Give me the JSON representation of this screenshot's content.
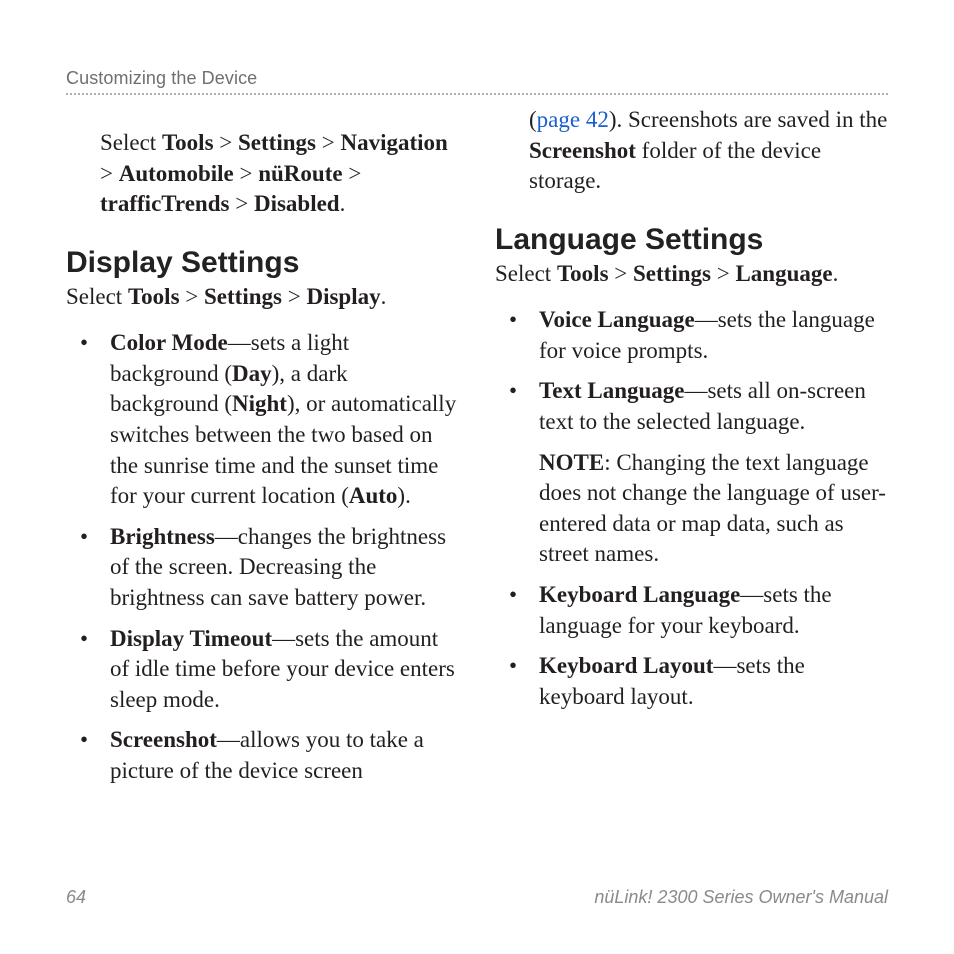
{
  "running_head": "Customizing the Device",
  "left": {
    "lead_in": {
      "prefix": "Select ",
      "crumbs": [
        "Tools",
        "Settings",
        "Navigation",
        "Automobile",
        "nüRoute",
        "trafficTrends",
        "Disabled"
      ],
      "sep": " > ",
      "suffix": "."
    },
    "section_title": "Display Settings",
    "subhead": {
      "prefix": "Select ",
      "crumbs": [
        "Tools",
        "Settings",
        "Display"
      ],
      "sep": " > ",
      "suffix": "."
    },
    "items": [
      {
        "term": "Color Mode",
        "parts": [
          "—sets a light background (",
          {
            "b": "Day"
          },
          "), a dark background (",
          {
            "b": "Night"
          },
          "), or automatically switches between the two based on the sunrise time and the sunset time for your current location (",
          {
            "b": "Auto"
          },
          ")."
        ]
      },
      {
        "term": "Brightness",
        "parts": [
          "—changes the brightness of the screen. Decreasing the brightness can save battery power."
        ]
      },
      {
        "term": "Display Timeout",
        "parts": [
          "—sets the amount of idle time before your device enters sleep mode."
        ]
      },
      {
        "term": "Screenshot",
        "parts": [
          "—allows you to take a picture of the device screen"
        ]
      }
    ]
  },
  "right": {
    "continuation": {
      "parts": [
        "(",
        {
          "link": "page 42"
        },
        "). Screenshots are saved in the ",
        {
          "b": "Screenshot"
        },
        " folder of the device storage."
      ]
    },
    "section_title": "Language Settings",
    "subhead": {
      "prefix": "Select ",
      "crumbs": [
        "Tools",
        "Settings",
        "Language"
      ],
      "sep": " > ",
      "suffix": "."
    },
    "items": [
      {
        "term": "Voice Language",
        "parts": [
          "—sets the language for voice prompts."
        ]
      },
      {
        "term": "Text Language",
        "parts": [
          "—sets all on-screen text to the selected language."
        ]
      },
      {
        "note": true,
        "parts": [
          {
            "b": "NOTE"
          },
          ": Changing the text language does not change the language of user-entered data or map data, such as street names."
        ]
      },
      {
        "term": "Keyboard Language",
        "parts": [
          "—sets the language for your keyboard."
        ]
      },
      {
        "term": "Keyboard Layout",
        "parts": [
          "—sets the keyboard layout."
        ]
      }
    ]
  },
  "footer": {
    "page_number": "64",
    "manual_title": "nüLink! 2300 Series Owner's Manual"
  }
}
